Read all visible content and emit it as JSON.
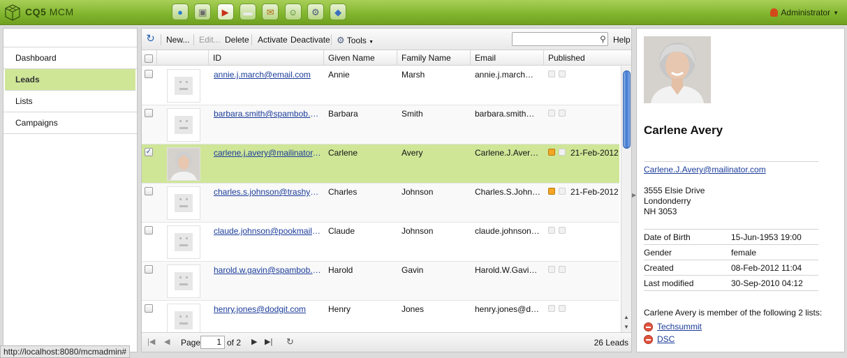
{
  "header": {
    "brand": "CQ5",
    "brand_sub": "MCM",
    "apps": [
      {
        "icon": "globe-icon",
        "glyph": "●",
        "color": "#2f7fd0"
      },
      {
        "icon": "camera-icon",
        "glyph": "▣",
        "color": "#6b6b6b"
      },
      {
        "icon": "megaphone-icon",
        "glyph": "▶",
        "color": "#c9301a"
      },
      {
        "icon": "speech-bubble-icon",
        "glyph": "▬",
        "color": "#eaeaea"
      },
      {
        "icon": "mail-icon",
        "glyph": "✉",
        "color": "#b06a10"
      },
      {
        "icon": "users-icon",
        "glyph": "☺",
        "color": "#3b7a20"
      },
      {
        "icon": "gears-icon",
        "glyph": "⚙",
        "color": "#4d5d7a"
      },
      {
        "icon": "tag-icon",
        "glyph": "◆",
        "color": "#3a6fc0"
      }
    ],
    "user": "Administrator"
  },
  "nav": {
    "items": [
      {
        "label": "Dashboard"
      },
      {
        "label": "Leads"
      },
      {
        "label": "Lists"
      },
      {
        "label": "Campaigns"
      }
    ],
    "active": "Leads"
  },
  "toolbar": {
    "new": "New...",
    "edit": "Edit...",
    "delete": "Delete",
    "activate": "Activate",
    "deactivate": "Deactivate",
    "tools": "Tools",
    "help": "Help",
    "search_value": ""
  },
  "columns": [
    "ID",
    "Given Name",
    "Family Name",
    "Email",
    "Published"
  ],
  "rows": [
    {
      "id": "annie.j.march@email.com",
      "given": "Annie",
      "family": "Marsh",
      "email": "annie.j.march@e...",
      "published": "",
      "pub_on": false,
      "selected": false
    },
    {
      "id": "barbara.smith@spambob.com",
      "given": "Barbara",
      "family": "Smith",
      "email": "barbara.smith@s...",
      "published": "",
      "pub_on": false,
      "selected": false
    },
    {
      "id": "carlene.j.avery@mailinator.com",
      "given": "Carlene",
      "family": "Avery",
      "email": "Carlene.J.Avery@...",
      "published": "21-Feb-2012",
      "pub_on": true,
      "selected": true
    },
    {
      "id": "charles.s.johnson@trashymail...",
      "given": "Charles",
      "family": "Johnson",
      "email": "Charles.S.Johnso...",
      "published": "21-Feb-2012",
      "pub_on": true,
      "selected": false
    },
    {
      "id": "claude.johnson@pookmail.com",
      "given": "Claude",
      "family": "Johnson",
      "email": "claude.johnson@...",
      "published": "",
      "pub_on": false,
      "selected": false
    },
    {
      "id": "harold.w.gavin@spambob.com",
      "given": "Harold",
      "family": "Gavin",
      "email": "Harold.W.Gavin@...",
      "published": "",
      "pub_on": false,
      "selected": false
    },
    {
      "id": "henry.jones@dodgit.com",
      "given": "Henry",
      "family": "Jones",
      "email": "henry.jones@dod...",
      "published": "",
      "pub_on": false,
      "selected": false
    }
  ],
  "pager": {
    "page_label": "Page",
    "current_page": "1",
    "of_label": "of 2",
    "total": "26 Leads"
  },
  "detail": {
    "name": "Carlene Avery",
    "email": "Carlene.J.Avery@mailinator.com",
    "address": [
      "3555 Elsie Drive",
      "Londonderry",
      "NH 3053"
    ],
    "properties": [
      {
        "label": "Date of Birth",
        "value": "15-Jun-1953 19:00"
      },
      {
        "label": "Gender",
        "value": "female"
      },
      {
        "label": "Created",
        "value": "08-Feb-2012 11:04"
      },
      {
        "label": "Last modified",
        "value": "30-Sep-2010 04:12"
      }
    ],
    "member_text": "Carlene Avery is member of the following 2 lists:",
    "lists": [
      "Techsummit",
      "DSC"
    ]
  },
  "statusbar": {
    "url": "http://localhost:8080/mcmadmin#"
  }
}
